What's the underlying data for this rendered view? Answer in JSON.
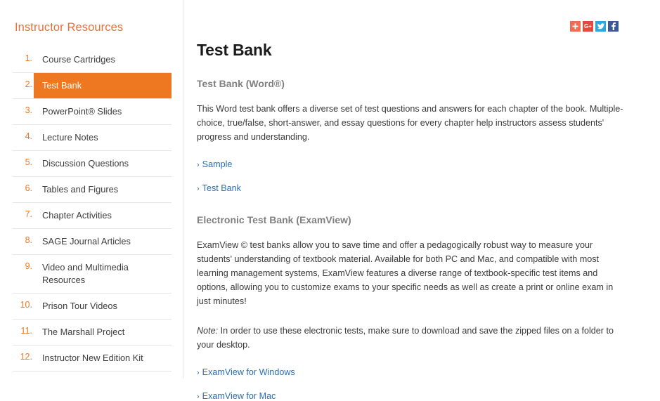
{
  "share": {
    "buttons": [
      {
        "name": "addthis-share-button",
        "icon": "plus-icon",
        "label": "+",
        "color": "#f26b56"
      },
      {
        "name": "googleplus-share-button",
        "icon": "google-plus-icon",
        "label": "G+",
        "color": "#e04b3c"
      },
      {
        "name": "twitter-share-button",
        "icon": "twitter-bird-icon",
        "label": "t",
        "color": "#29a9e0"
      },
      {
        "name": "facebook-share-button",
        "icon": "facebook-f-icon",
        "label": "f",
        "color": "#3b5998"
      }
    ]
  },
  "sidebar": {
    "title": "Instructor Resources",
    "items": [
      {
        "num": "1.",
        "label": "Course Cartridges",
        "active": false
      },
      {
        "num": "2.",
        "label": "Test Bank",
        "active": true
      },
      {
        "num": "3.",
        "label": "PowerPoint® Slides",
        "active": false
      },
      {
        "num": "4.",
        "label": "Lecture Notes",
        "active": false
      },
      {
        "num": "5.",
        "label": "Discussion Questions",
        "active": false
      },
      {
        "num": "6.",
        "label": "Tables and Figures",
        "active": false
      },
      {
        "num": "7.",
        "label": "Chapter Activities",
        "active": false
      },
      {
        "num": "8.",
        "label": "SAGE Journal Articles",
        "active": false
      },
      {
        "num": "9.",
        "label": "Video and Multimedia Resources",
        "active": false
      },
      {
        "num": "10.",
        "label": "Prison Tour Videos",
        "active": false
      },
      {
        "num": "11.",
        "label": "The Marshall Project",
        "active": false
      },
      {
        "num": "12.",
        "label": "Instructor New Edition Kit",
        "active": false
      }
    ]
  },
  "main": {
    "title": "Test Bank",
    "section1": {
      "heading": "Test Bank (Word®)",
      "paragraph": "This Word test bank offers a diverse set of test questions and answers for each chapter of the book. Multiple-choice, true/false, short-answer, and essay questions for every chapter help instructors assess students' progress and understanding.",
      "links": [
        {
          "chevron": "›",
          "label": "Sample"
        },
        {
          "chevron": "›",
          "label": "Test Bank"
        }
      ]
    },
    "section2": {
      "heading": "Electronic Test Bank (ExamView)",
      "paragraph": "ExamView © test banks allow you to save time and offer a pedagogically robust way to measure your students' understanding of textbook material. Available for both PC and Mac, and compatible with most learning management systems, ExamView features a diverse range of textbook-specific test items and options, allowing you to customize exams to your specific needs as well as create a print or online exam in just minutes!",
      "note_label": "Note:",
      "note_text": " In order to use these electronic tests, make sure to download and save the zipped files on a folder to your desktop.",
      "links": [
        {
          "chevron": "›",
          "label": "ExamView for Windows"
        },
        {
          "chevron": "›",
          "label": "ExamView for Mac"
        }
      ]
    }
  },
  "colors": {
    "accent_orange": "#ee7722",
    "title_orange": "#e8703a",
    "link_blue": "#2a6ebb",
    "heading_gray": "#808080"
  }
}
